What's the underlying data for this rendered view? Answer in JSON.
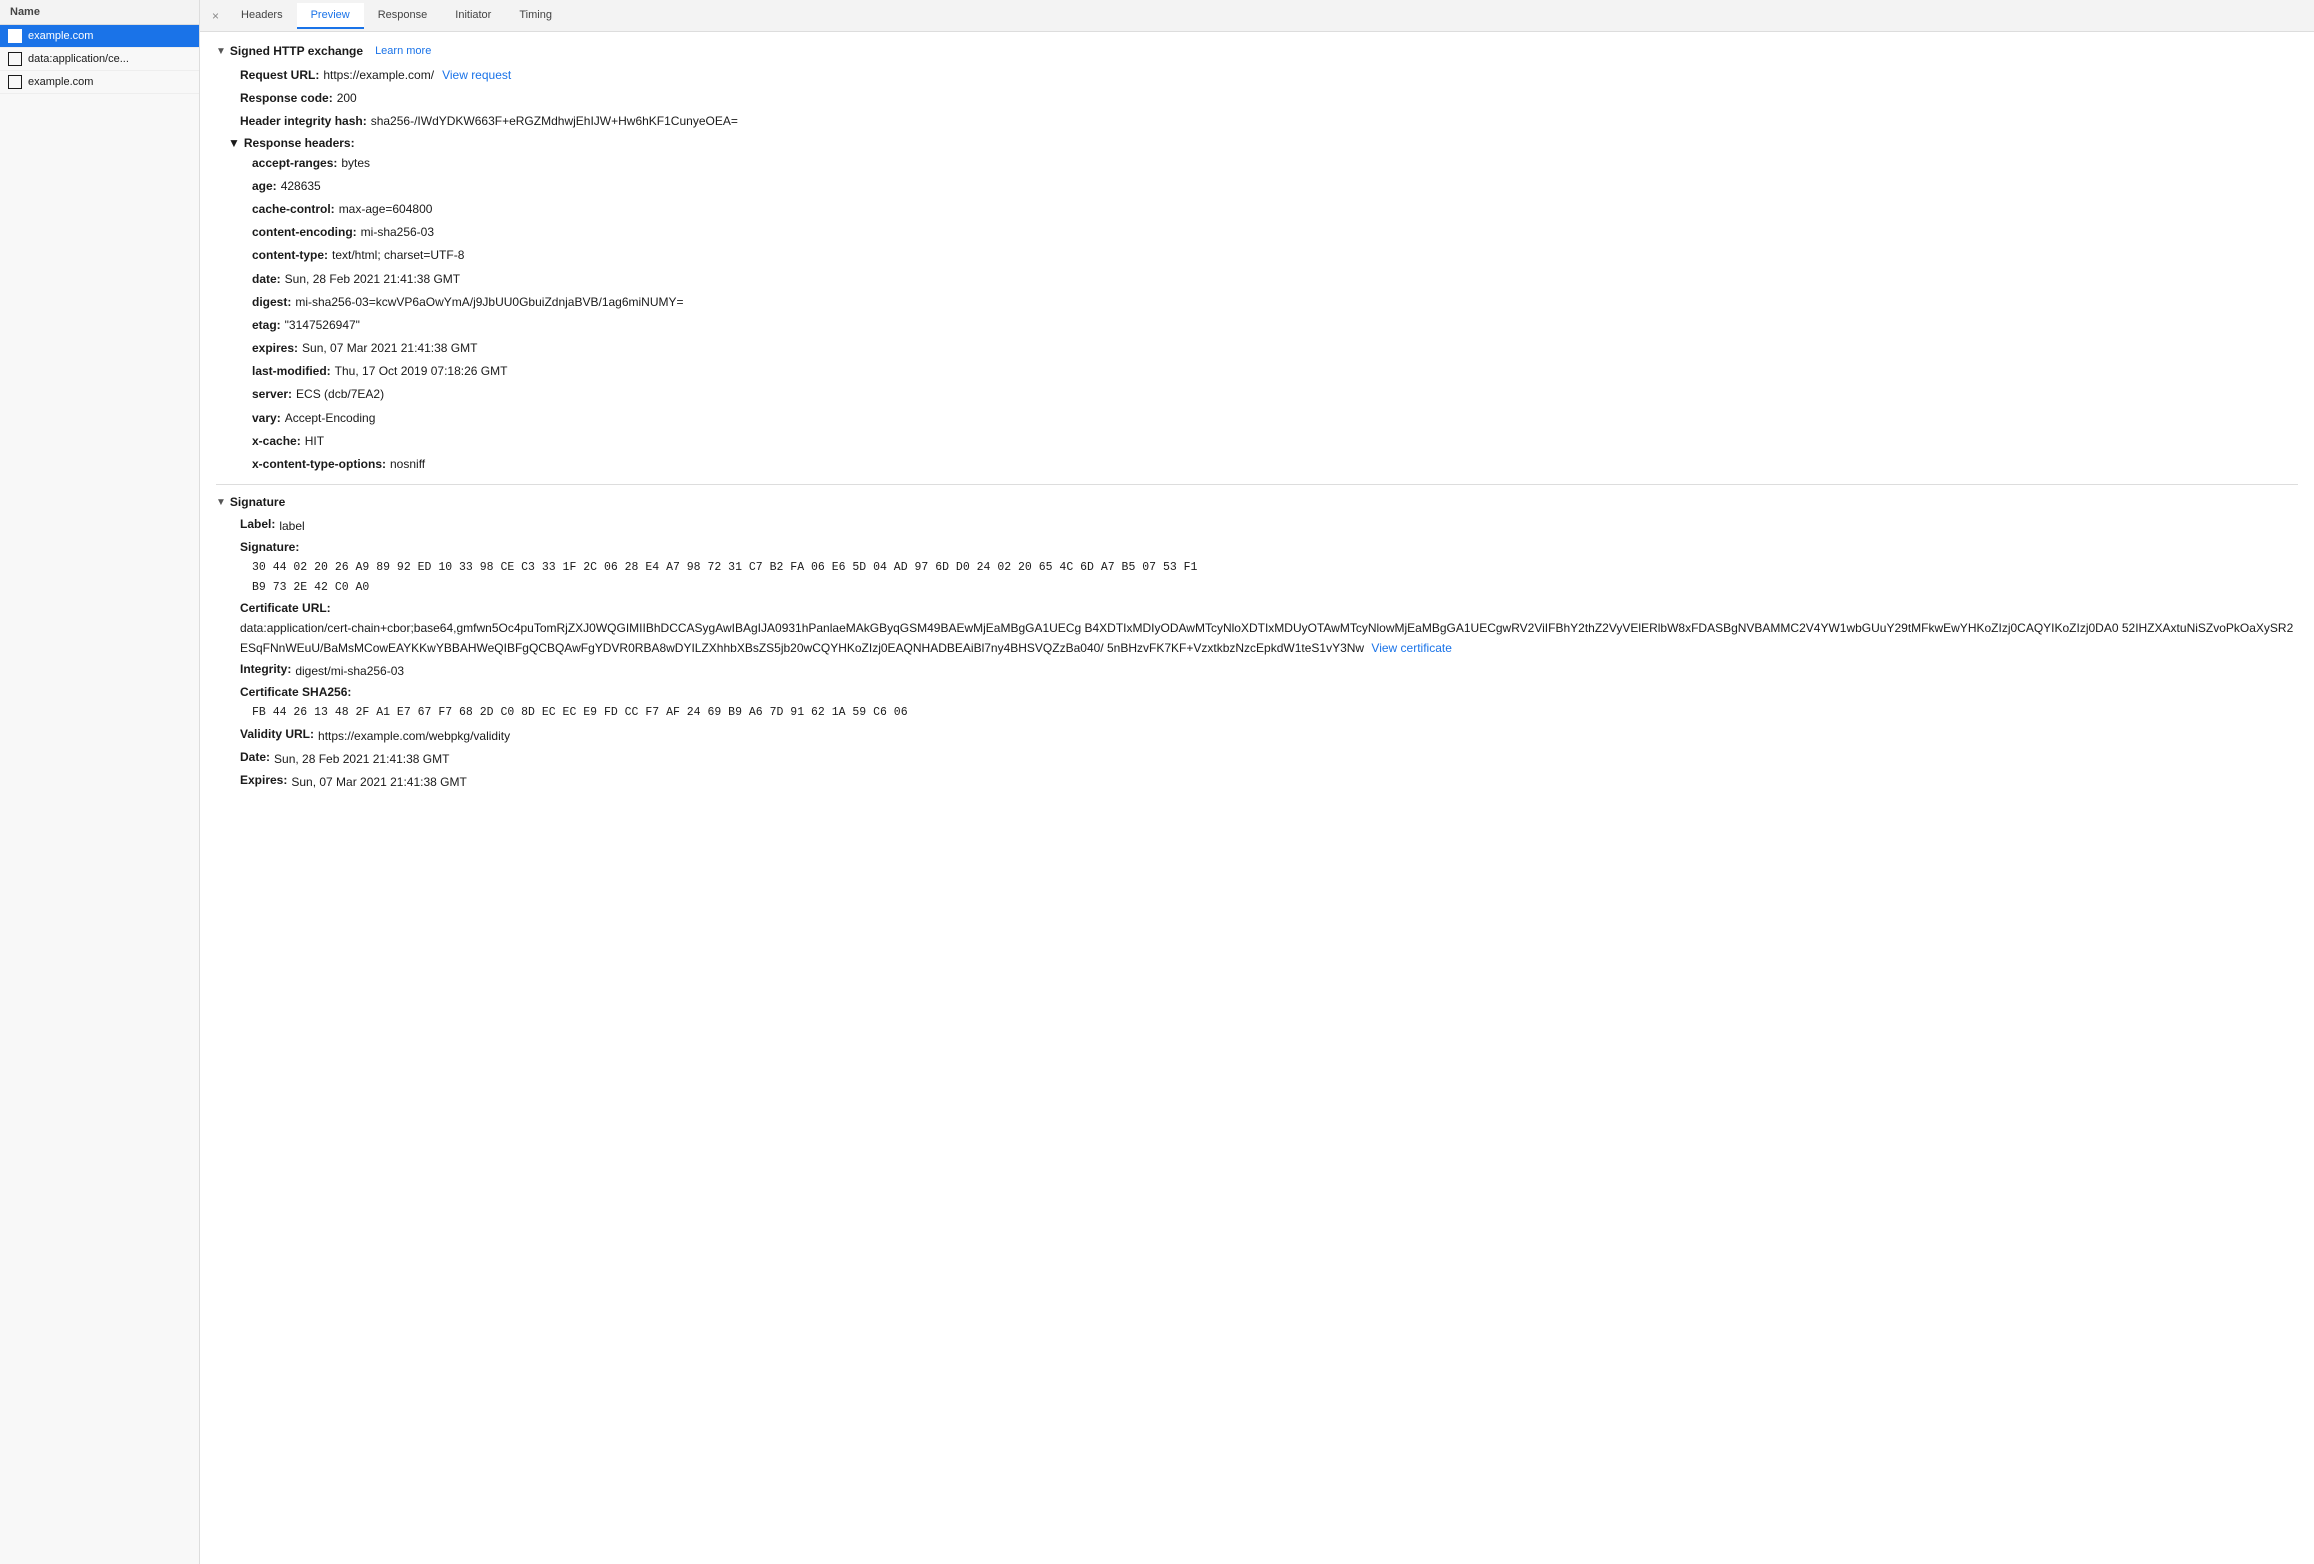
{
  "sidebar": {
    "header": "Name",
    "items": [
      {
        "label": "example.com",
        "active": true
      },
      {
        "label": "data:application/ce...",
        "active": false
      },
      {
        "label": "example.com",
        "active": false
      }
    ]
  },
  "tabs": {
    "close": "×",
    "items": [
      {
        "label": "Headers",
        "active": false
      },
      {
        "label": "Preview",
        "active": true
      },
      {
        "label": "Response",
        "active": false
      },
      {
        "label": "Initiator",
        "active": false
      },
      {
        "label": "Timing",
        "active": false
      }
    ]
  },
  "signed_http_exchange": {
    "title": "Signed HTTP exchange",
    "learn_more": "Learn more",
    "request_url_label": "Request URL:",
    "request_url_value": "https://example.com/",
    "view_request_label": "View request",
    "response_code_label": "Response code:",
    "response_code_value": "200",
    "header_integrity_label": "Header integrity hash:",
    "header_integrity_value": "sha256-/IWdYDKW663F+eRGZMdhwjEhIJW+Hw6hKF1CunyeOEA=",
    "response_headers": {
      "title": "Response headers:",
      "fields": [
        {
          "label": "accept-ranges:",
          "value": "bytes"
        },
        {
          "label": "age:",
          "value": "428635"
        },
        {
          "label": "cache-control:",
          "value": "max-age=604800"
        },
        {
          "label": "content-encoding:",
          "value": "mi-sha256-03"
        },
        {
          "label": "content-type:",
          "value": "text/html; charset=UTF-8"
        },
        {
          "label": "date:",
          "value": "Sun, 28 Feb 2021 21:41:38 GMT"
        },
        {
          "label": "digest:",
          "value": "mi-sha256-03=kcwVP6aOwYmA/j9JbUU0GbuiZdnjaBVB/1ag6miNUMY="
        },
        {
          "label": "etag:",
          "value": "\"3147526947\""
        },
        {
          "label": "expires:",
          "value": "Sun, 07 Mar 2021 21:41:38 GMT"
        },
        {
          "label": "last-modified:",
          "value": "Thu, 17 Oct 2019 07:18:26 GMT"
        },
        {
          "label": "server:",
          "value": "ECS (dcb/7EA2)"
        },
        {
          "label": "vary:",
          "value": "Accept-Encoding"
        },
        {
          "label": "x-cache:",
          "value": "HIT"
        },
        {
          "label": "x-content-type-options:",
          "value": "nosniff"
        }
      ]
    }
  },
  "signature": {
    "title": "Signature",
    "label_label": "Label:",
    "label_value": "label",
    "signature_label": "Signature:",
    "signature_line1": "30 44 02 20 26 A9 89 92 ED 10 33 98 CE C3 33 1F 2C 06 28 E4 A7 98 72 31 C7 B2 FA 06 E6 5D 04 AD 97 6D D0 24 02 20 65 4C 6D A7 B5 07 53 F1",
    "signature_line2": "B9 73 2E 42 C0 A0",
    "cert_url_label": "Certificate URL:",
    "cert_url_line1": "data:application/cert-chain+cbor;base64,gmfwn5Oc4puTomRjZXJ0WQGIMIIBhDCCASygAwIBAgIJA0931hPanlaeMAkGByqGSM49BAEwMjEaMBgGA1UECg",
    "cert_url_line2": "B4XDTIxMDIyODAwMTcyNloXDTIxMDUyOTAwMTcyNlowMjEaMBgGA1UECgwRV2ViIFBhY2thZ2VyVElERlbW8xFDASBgNVBAMMC2V4YW1wbGUuY29tMFkwEwYHKoZIzj0CAQYIKoZIzj0DA0",
    "cert_url_line3": "52IHZXAxtuNiSZvoPkOaXySR2ESqFNnWEuU/BaMsMCowEAYKKwYBBAHWeQIBFgQCBQAwFgYDVR0RBA8wDYILZXhhbXBsZS5jb20wCQYHKoZIzj0EAQNHADBEAiBl7ny4BHSVQZzBa040/",
    "cert_url_line4": "5nBHzvFK7KF+VzxtkbzNzcEpkdW1teS1vY3Nw",
    "view_certificate": "View certificate",
    "integrity_label": "Integrity:",
    "integrity_value": "digest/mi-sha256-03",
    "cert_sha256_label": "Certificate SHA256:",
    "cert_sha256_value": "FB 44 26 13 48 2F A1 E7 67 F7 68 2D C0 8D EC EC E9 FD CC F7 AF 24 69 B9 A6 7D 91 62 1A 59 C6 06",
    "validity_url_label": "Validity URL:",
    "validity_url_value": "https://example.com/webpkg/validity",
    "date_label": "Date:",
    "date_value": "Sun, 28 Feb 2021 21:41:38 GMT",
    "expires_label": "Expires:",
    "expires_value": "Sun, 07 Mar 2021 21:41:38 GMT"
  }
}
